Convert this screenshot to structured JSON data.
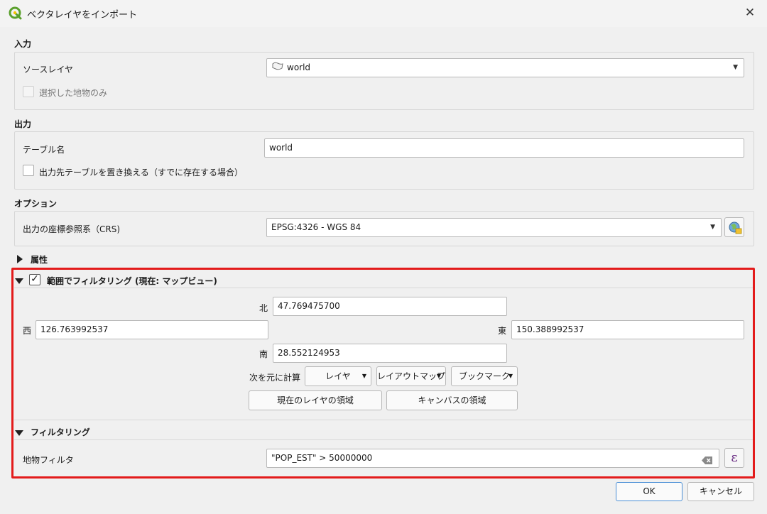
{
  "window": {
    "title": "ベクタレイヤをインポート"
  },
  "input_section": {
    "title": "入力",
    "source_layer_label": "ソースレイヤ",
    "source_layer_value": "world",
    "selected_only_label": "選択した地物のみ"
  },
  "output_section": {
    "title": "出力",
    "table_name_label": "テーブル名",
    "table_name_value": "world",
    "replace_label": "出力先テーブルを置き換える（すでに存在する場合）"
  },
  "options_section": {
    "title": "オプション",
    "crs_label": "出力の座標参照系（CRS)",
    "crs_value": "EPSG:4326 - WGS 84"
  },
  "attributes_section": {
    "title": "属性"
  },
  "extent_section": {
    "title": "範囲でフィルタリング (現在: マップビュー)",
    "north_label": "北",
    "north_value": "47.769475700",
    "west_label": "西",
    "west_value": "126.763992537",
    "east_label": "東",
    "east_value": "150.388992537",
    "south_label": "南",
    "south_value": "28.552124953",
    "calc_from_label": "次を元に計算",
    "layer_btn": "レイヤ",
    "layout_map_btn": "レイアウトマップ",
    "bookmark_btn": "ブックマーク",
    "current_layer_extent_btn": "現在のレイヤの領域",
    "canvas_extent_btn": "キャンバスの領域"
  },
  "filter_section": {
    "title": "フィルタリング",
    "feature_filter_label": "地物フィルタ",
    "feature_filter_value": "\"POP_EST\" > 50000000"
  },
  "buttons": {
    "ok": "OK",
    "cancel": "キャンセル"
  },
  "colors": {
    "highlight": "#e31b1b",
    "qgis_green": "#5aa02c"
  }
}
